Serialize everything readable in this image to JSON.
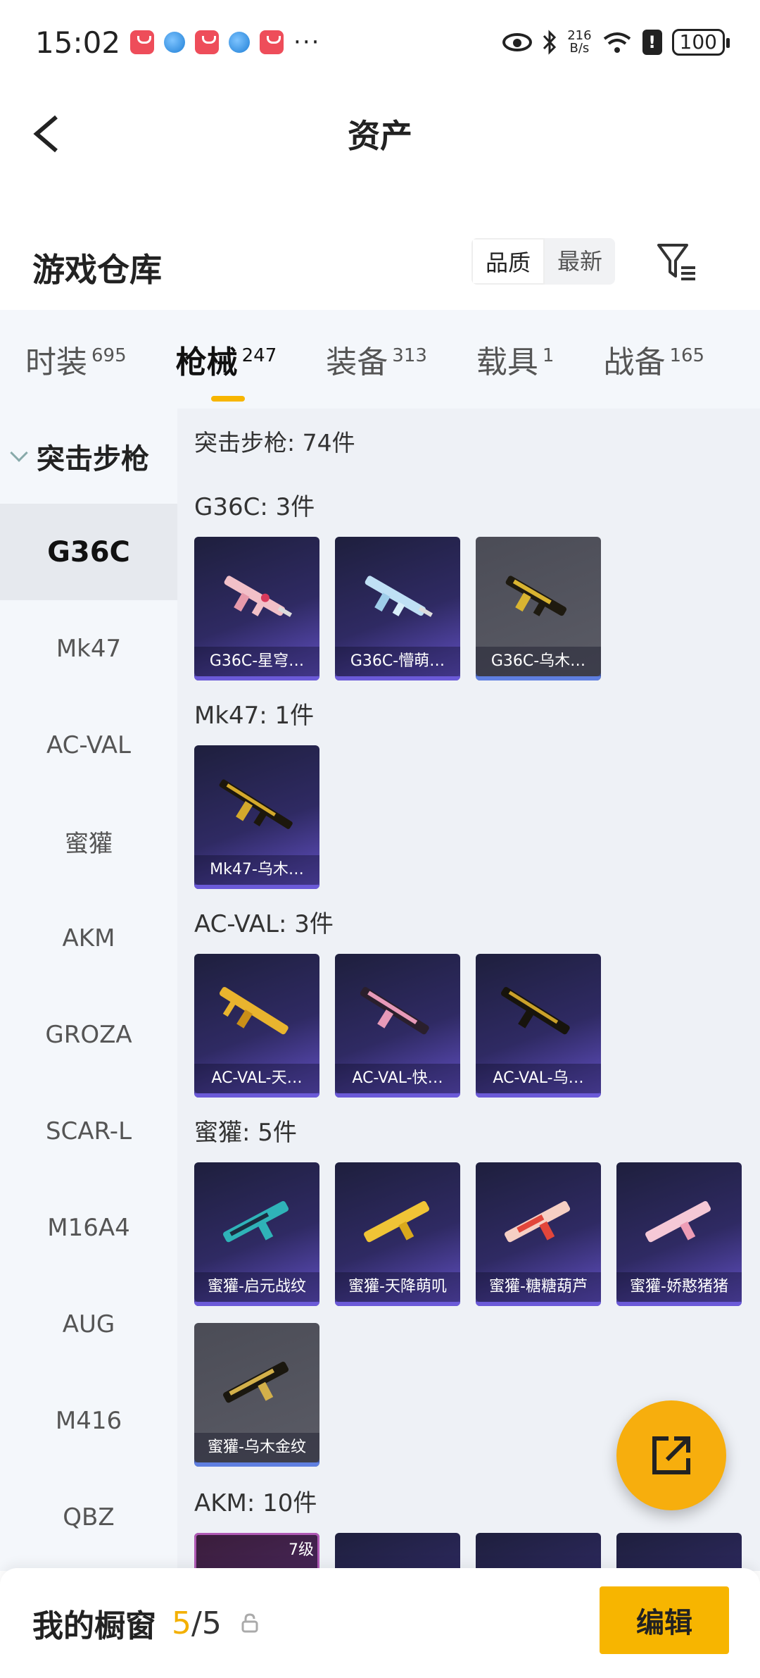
{
  "status_bar": {
    "time": "15:02",
    "net_speed_value": "216",
    "net_speed_unit": "B/s",
    "battery": "100"
  },
  "header": {
    "title": "资产",
    "back_icon": "back-arrow-icon"
  },
  "warehouse": {
    "title": "游戏仓库",
    "sort_options": [
      "品质",
      "最新"
    ],
    "active_sort": "品质",
    "filter_icon": "filter-icon"
  },
  "tabs": [
    {
      "label": "时装",
      "count": "695"
    },
    {
      "label": "枪械",
      "count": "247",
      "active": true
    },
    {
      "label": "装备",
      "count": "313"
    },
    {
      "label": "载具",
      "count": "1"
    },
    {
      "label": "战备",
      "count": "165"
    }
  ],
  "sidebar": {
    "group": "突击步枪",
    "items": [
      "G36C",
      "Mk47",
      "AC-VAL",
      "蜜獾",
      "AKM",
      "GROZA",
      "SCAR-L",
      "M16A4",
      "AUG",
      "M416",
      "QBZ"
    ],
    "active": "G36C"
  },
  "content": {
    "total": "突击步枪: 74件",
    "sections": [
      {
        "title": "G36C: 3件",
        "items": [
          "G36C-星穹…",
          "G36C-懵萌…",
          "G36C-乌木…"
        ]
      },
      {
        "title": "Mk47: 1件",
        "items": [
          "Mk47-乌木…"
        ]
      },
      {
        "title": "AC-VAL: 3件",
        "items": [
          "AC-VAL-天…",
          "AC-VAL-快…",
          "AC-VAL-乌…"
        ]
      },
      {
        "title": "蜜獾: 5件",
        "items": [
          "蜜獾-启元战纹",
          "蜜獾-天降萌叽",
          "蜜獾-糖糖葫芦",
          "蜜獾-娇憨猪猪",
          "蜜獾-乌木金纹"
        ]
      },
      {
        "title": "AKM: 10件",
        "items": [],
        "first_level": "7级"
      }
    ]
  },
  "fab": {
    "icon": "share-icon"
  },
  "bottom_bar": {
    "title": "我的橱窗",
    "count_current": "5",
    "count_separator": "/",
    "count_max": "5",
    "edit_label": "编辑"
  },
  "colors": {
    "accent": "#f7b500",
    "card_purple": "#2f2a63",
    "card_grey": "#4b4c56"
  }
}
